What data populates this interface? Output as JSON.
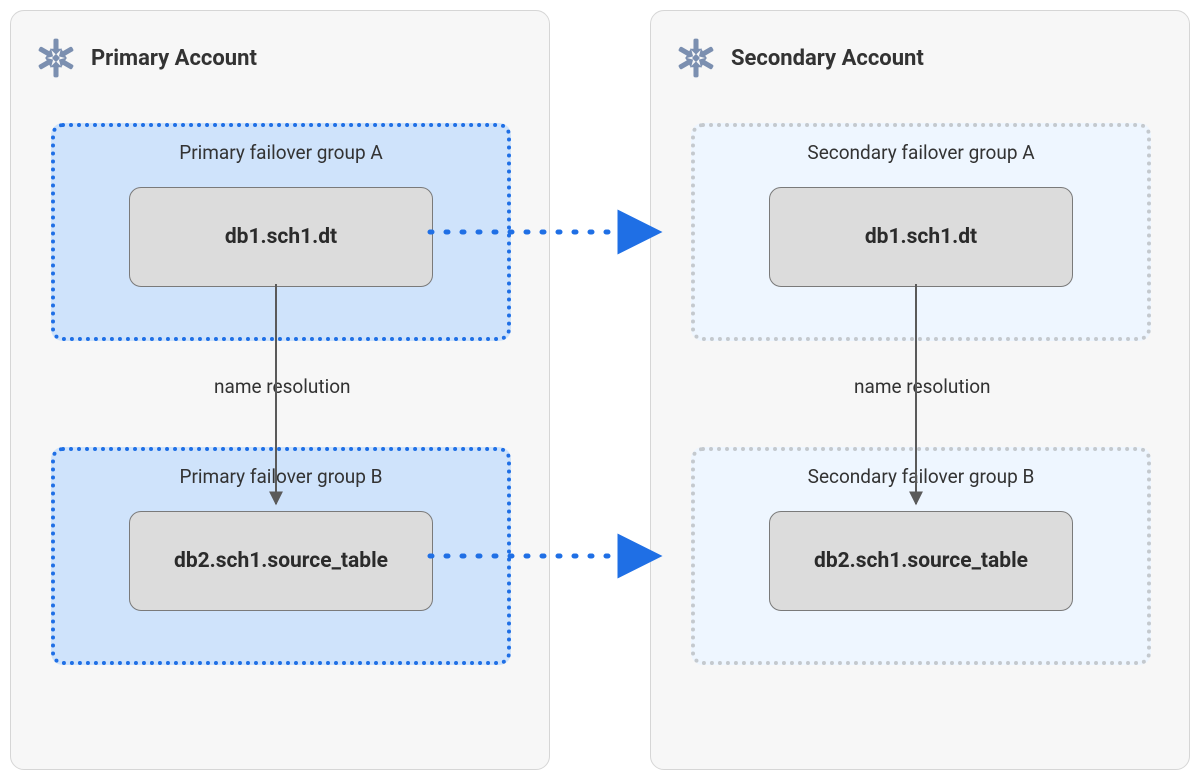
{
  "primary": {
    "title": "Primary Account",
    "groupA": {
      "label": "Primary failover group A",
      "entity": "db1.sch1.dt"
    },
    "groupB": {
      "label": "Primary failover group B",
      "entity": "db2.sch1.source_table"
    },
    "resolution_label": "name resolution"
  },
  "secondary": {
    "title": "Secondary Account",
    "groupA": {
      "label": "Secondary failover group A",
      "entity": "db1.sch1.dt"
    },
    "groupB": {
      "label": "Secondary failover group B",
      "entity": "db2.sch1.source_table"
    },
    "resolution_label": "name resolution"
  },
  "colors": {
    "primary_dot": "#1f6fe5",
    "secondary_dot": "#c4c9ce",
    "arrow_blue": "#1f6fe5",
    "arrow_gray": "#5a5a5a",
    "panel_bg": "#f7f7f7",
    "panel_border": "#d6d6d6",
    "entity_bg": "#dcdcdc",
    "entity_border": "#7a7a7a",
    "snowflake": "#7b8fb0"
  }
}
